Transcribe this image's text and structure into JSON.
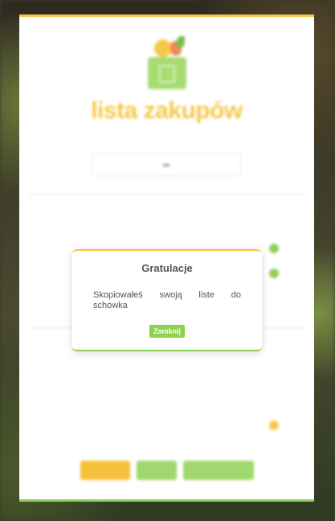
{
  "colors": {
    "brand_yellow": "#f6c84a",
    "brand_green": "#8ecf5a",
    "button_green": "#8ed24a"
  },
  "modal": {
    "title": "Gratulacje",
    "message": "Skopiowałeś swoją liste do schowka",
    "close_label": "Zamknij"
  },
  "background_app": {
    "title": "lista zakupów",
    "logo_icon": "shopping-basket-icon"
  }
}
